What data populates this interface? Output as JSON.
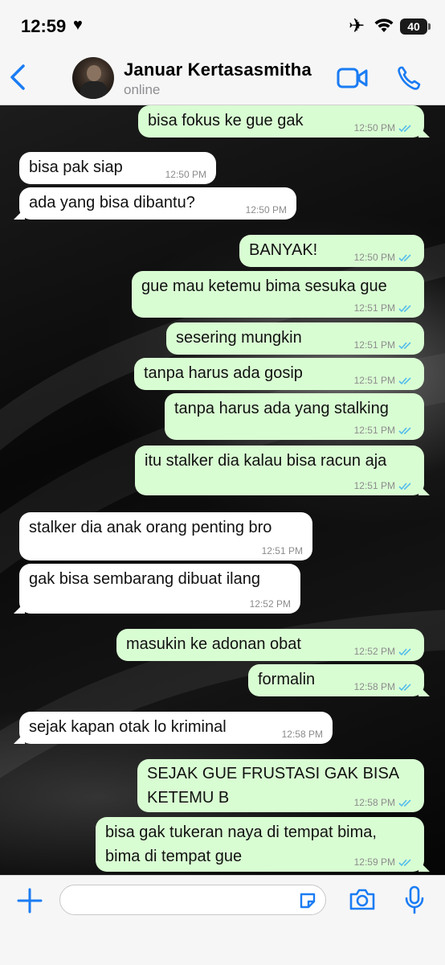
{
  "status_bar": {
    "time": "12:59",
    "battery": "40"
  },
  "header": {
    "contact_name": "Januar Kertasasmitha",
    "presence": "online"
  },
  "messages": [
    {
      "dir": "out",
      "text": "bisa fokus ke gue gak",
      "time": "12:50 PM",
      "read": true
    },
    {
      "dir": "in",
      "text": "bisa pak siap",
      "time": "12:50 PM"
    },
    {
      "dir": "in",
      "text": "ada yang bisa dibantu?",
      "time": "12:50 PM"
    },
    {
      "dir": "out",
      "text": "BANYAK!",
      "time": "12:50 PM",
      "read": true
    },
    {
      "dir": "out",
      "text": "gue mau ketemu bima sesuka gue",
      "time": "12:51 PM",
      "read": true
    },
    {
      "dir": "out",
      "text": "sesering mungkin",
      "time": "12:51 PM",
      "read": true
    },
    {
      "dir": "out",
      "text": "tanpa harus ada gosip",
      "time": "12:51 PM",
      "read": true
    },
    {
      "dir": "out",
      "text": "tanpa harus ada yang stalking",
      "time": "12:51 PM",
      "read": true
    },
    {
      "dir": "out",
      "text": "itu stalker dia kalau bisa racun aja",
      "time": "12:51 PM",
      "read": true
    },
    {
      "dir": "in",
      "text": "stalker dia anak orang penting bro",
      "time": "12:51 PM"
    },
    {
      "dir": "in",
      "text": "gak bisa sembarang dibuat ilang",
      "time": "12:52 PM"
    },
    {
      "dir": "out",
      "text": "masukin ke adonan obat",
      "time": "12:52 PM",
      "read": true
    },
    {
      "dir": "out",
      "text": "formalin",
      "time": "12:58 PM",
      "read": true
    },
    {
      "dir": "in",
      "text": "sejak kapan otak lo kriminal",
      "time": "12:58 PM"
    },
    {
      "dir": "out",
      "text": "SEJAK GUE FRUSTASI GAK BISA",
      "text2": "KETEMU B",
      "time": "12:58 PM",
      "read": true
    },
    {
      "dir": "out",
      "text": "bisa gak tukeran naya di tempat bima,",
      "text2": "bima di tempat gue",
      "time": "12:59 PM",
      "read": true
    }
  ],
  "composer": {
    "placeholder": ""
  },
  "colors": {
    "accent": "#1a7cf3",
    "outgoing_bubble": "#d9fdd3",
    "incoming_bubble": "#ffffff",
    "read_ticks": "#53bdeb"
  },
  "icons": [
    "back-chevron-icon",
    "video-call-icon",
    "phone-icon",
    "plus-icon",
    "sticker-icon",
    "camera-icon",
    "microphone-icon",
    "airplane-icon",
    "wifi-icon",
    "heart-icon"
  ]
}
